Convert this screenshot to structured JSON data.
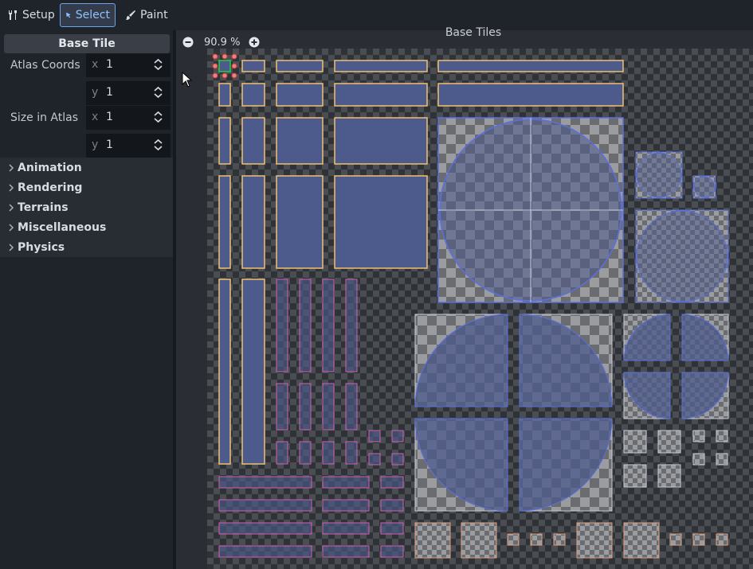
{
  "toolbar": {
    "setup_label": "Setup",
    "select_label": "Select",
    "paint_label": "Paint",
    "active_tab": "select"
  },
  "inspector": {
    "header": "Base Tile",
    "atlas_coords_label": "Atlas Coords",
    "atlas_coords": {
      "x_axis": "x",
      "x": "1",
      "y_axis": "y",
      "y": "1"
    },
    "size_in_atlas_label": "Size in Atlas",
    "size_in_atlas": {
      "x_axis": "x",
      "x": "1",
      "y_axis": "y",
      "y": "1"
    },
    "groups": [
      {
        "label": "Animation"
      },
      {
        "label": "Rendering"
      },
      {
        "label": "Terrains"
      },
      {
        "label": "Miscellaneous"
      },
      {
        "label": "Physics"
      }
    ]
  },
  "editor": {
    "title": "Base Tiles",
    "zoom": "90.9 %",
    "icons": [
      "zoom-out-icon",
      "zoom-in-icon",
      "mouse-cursor-icon"
    ]
  },
  "colors": {
    "accent": "#6aa5e8",
    "tile_outline_orange": "#f0c070",
    "tile_outline_pink": "#d060b0",
    "tile_fill": "#4c5a8c",
    "circle_outline": "#5a70e0",
    "selection_handle": "#f08080"
  }
}
